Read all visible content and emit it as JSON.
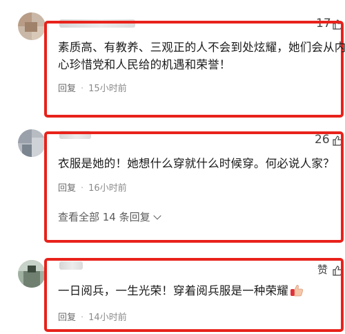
{
  "comments": [
    {
      "like_count": "17",
      "text_lines": [
        "素质高、有教养、三观正的人不会到处炫耀，她们会从内",
        "心珍惜党和人民给的机遇和荣誉！"
      ],
      "reply_label": "回复",
      "time": "15小时前"
    },
    {
      "like_count": "26",
      "text_lines": [
        "衣服是她的！她想什么穿就什么时候穿。何必说人家？"
      ],
      "reply_label": "回复",
      "time": "16小时前",
      "expand_label": "查看全部 14 条回复"
    },
    {
      "like_label": "赞",
      "text_lines": [
        "一日阅兵，一生光荣！穿着阅兵服是一种荣耀"
      ],
      "reply_label": "回复",
      "time": "14小时前"
    }
  ],
  "colors": {
    "highlight_border": "#e8221b",
    "meta_text": "#8a8a8a"
  },
  "icons": {
    "like": "thumb-up-icon",
    "expand": "chevron-down-icon",
    "emoji": "clapping-hands-icon"
  }
}
